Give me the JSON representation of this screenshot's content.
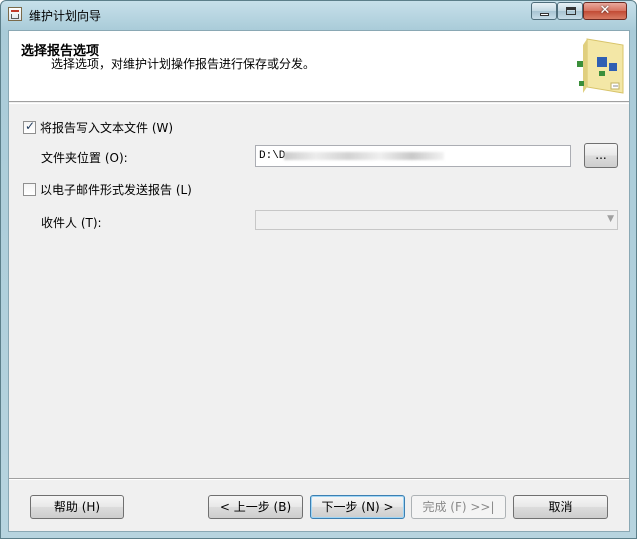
{
  "window": {
    "title": "维护计划向导",
    "controls": {
      "minimize_icon": "minimize-icon",
      "maximize_icon": "maximize-icon",
      "close_icon": "close-icon"
    }
  },
  "header": {
    "title": "选择报告选项",
    "subtitle": "选择选项，对维护计划操作报告进行保存或分发。",
    "graphic_icon": "wizard-graphic-icon"
  },
  "options": {
    "write_to_file": {
      "label": "将报告写入文本文件 (W)",
      "checked": true
    },
    "folder": {
      "label": "文件夹位置 (O):",
      "value": "D:\\D",
      "browse_label": "..."
    },
    "email": {
      "label": "以电子邮件形式发送报告 (L)",
      "checked": false
    },
    "recipient": {
      "label": "收件人 (T):",
      "value": ""
    }
  },
  "footer": {
    "help": "帮助 (H)",
    "back": "< 上一步 (B)",
    "next": "下一步 (N) >",
    "finish": "完成 (F) >>|",
    "cancel": "取消"
  },
  "colors": {
    "titlebar": "#b7d4df",
    "close_button": "#c24b35",
    "dialog_background": "#f0f0f0",
    "default_button_border": "#3c7fb1"
  }
}
